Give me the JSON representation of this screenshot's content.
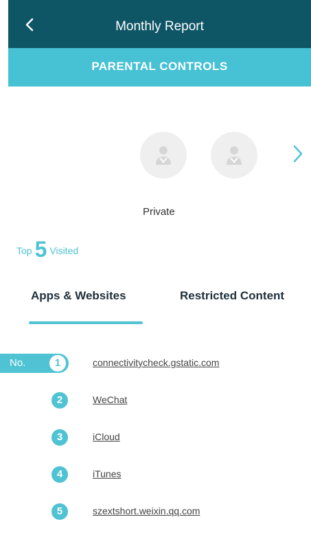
{
  "header": {
    "title": "Monthly Report",
    "back_icon": "chevron-left-icon"
  },
  "banner": {
    "title": "PARENTAL CONTROLS"
  },
  "device": {
    "name": "Private",
    "next_icon": "chevron-right-icon"
  },
  "summary": {
    "prefix": "Top",
    "count": "5",
    "suffix": "Visited"
  },
  "tabs": [
    {
      "label": "Apps & Websites",
      "active": true
    },
    {
      "label": "Restricted Content",
      "active": false
    }
  ],
  "ranking": {
    "first_prefix": "No.",
    "items": [
      {
        "rank": "1",
        "name": "connectivitycheck.gstatic.com"
      },
      {
        "rank": "2",
        "name": "WeChat"
      },
      {
        "rank": "3",
        "name": "iCloud"
      },
      {
        "rank": "4",
        "name": "iTunes"
      },
      {
        "rank": "5",
        "name": "szextshort.weixin.qq.com"
      }
    ]
  },
  "colors": {
    "nav": "#0e5566",
    "accent": "#47c1d4",
    "badge": "#4fc3d3"
  }
}
